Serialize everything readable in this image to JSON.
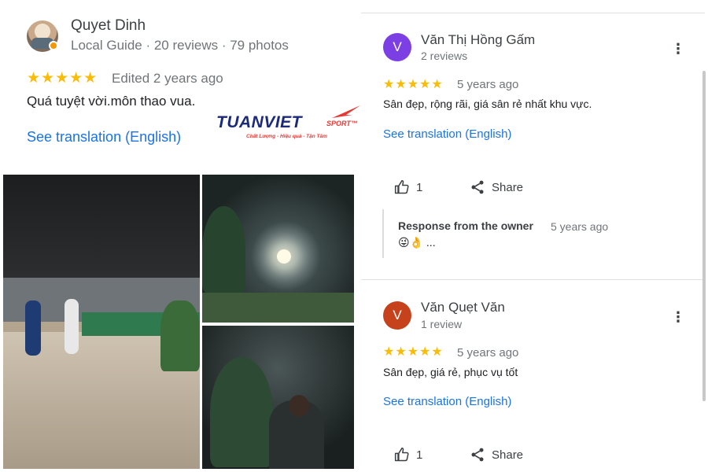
{
  "left_review": {
    "name": "Quyet Dinh",
    "meta": "Local Guide · 20 reviews · 79 photos",
    "stars": "★★★★★",
    "rating": 5,
    "edited": "Edited 2 years ago",
    "text": "Quá tuyệt vời.môn thao vua.",
    "translate": "See translation (English)"
  },
  "logo": {
    "main": "TUANVIET",
    "sport": "SPORT™",
    "tagline": "Chất Lượng - Hiệu quả - Tận Tâm"
  },
  "reviews": [
    {
      "avatar_letter": "V",
      "avatar_color": "#7b3fe4",
      "name": "Văn Thị Hồng Gấm",
      "meta": "2 reviews",
      "stars": "★★★★★",
      "rating": 5,
      "time": "5 years ago",
      "text": "Sân đẹp, rộng rãi, giá sân rẻ nhất khu vực.",
      "translate": "See translation (English)",
      "like_count": "1",
      "share_label": "Share",
      "owner_response": {
        "title": "Response from the owner",
        "time": "5 years ago",
        "text": "😜👌 ..."
      }
    },
    {
      "avatar_letter": "V",
      "avatar_color": "#c5421c",
      "name": "Văn Quẹt Văn",
      "meta": "1 review",
      "stars": "★★★★★",
      "rating": 5,
      "time": "5 years ago",
      "text": "Sân đẹp, giá rẻ, phục vụ tốt",
      "translate": "See translation (English)",
      "like_count": "1",
      "share_label": "Share"
    }
  ],
  "colors": {
    "star": "#fbbc04",
    "link": "#1a73e8",
    "muted": "#70757a"
  }
}
